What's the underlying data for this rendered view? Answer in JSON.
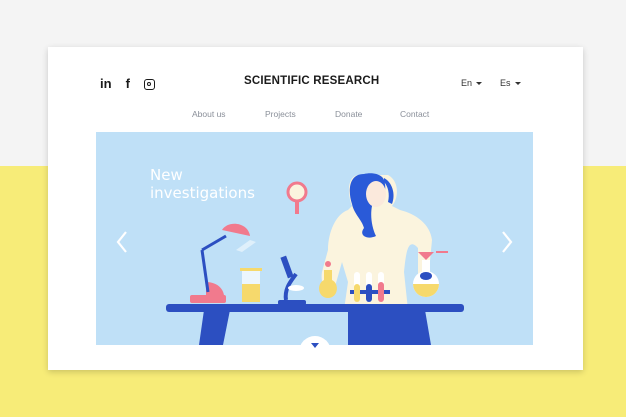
{
  "header": {
    "brand": "SCIENTIFIC RESEARCH",
    "social": [
      {
        "name": "linkedin",
        "glyph": "in"
      },
      {
        "name": "facebook",
        "glyph": "f"
      },
      {
        "name": "instagram",
        "glyph": ""
      }
    ],
    "languages": [
      "En",
      "Es"
    ]
  },
  "nav": {
    "items": [
      "About us",
      "Projects",
      "Donate",
      "Contact"
    ]
  },
  "hero": {
    "headline_line1": "New",
    "headline_line2": "investigations"
  },
  "colors": {
    "page_bg": "#f4f4f4",
    "accent_yellow": "#f7ec78",
    "hero_bg": "#bfe0f7",
    "table_blue": "#2c4fc1",
    "hair_blue": "#2a5ad8",
    "lamp_pink": "#f17a8d"
  }
}
